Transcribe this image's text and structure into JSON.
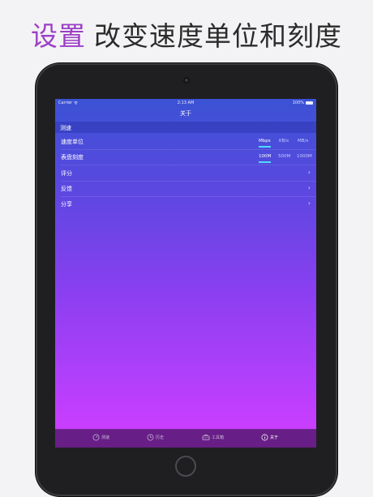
{
  "headline": {
    "accent": "设置",
    "rest": "改变速度单位和刻度"
  },
  "status": {
    "carrier": "Carrier",
    "time": "2:13 AM",
    "battery": "100%"
  },
  "nav": {
    "title": "关于"
  },
  "section": {
    "title": "测速"
  },
  "speed_unit": {
    "label": "速度单位",
    "options": [
      "Mbps",
      "KB/s",
      "MB/s"
    ],
    "selected": "Mbps"
  },
  "dial_scale": {
    "label": "表盘刻度",
    "options": [
      "100M",
      "500M",
      "1000M"
    ],
    "selected": "100M"
  },
  "rows": [
    {
      "label": "评分"
    },
    {
      "label": "反馈"
    },
    {
      "label": "分享"
    }
  ],
  "tabs": [
    {
      "label": "测速",
      "icon": "speedometer-icon"
    },
    {
      "label": "历史",
      "icon": "clock-icon"
    },
    {
      "label": "工具箱",
      "icon": "toolbox-icon"
    },
    {
      "label": "关于",
      "icon": "info-icon"
    }
  ],
  "active_tab": "关于",
  "colors": {
    "accent": "#9b3fc6",
    "segment_underline": "#4fd9ff"
  }
}
